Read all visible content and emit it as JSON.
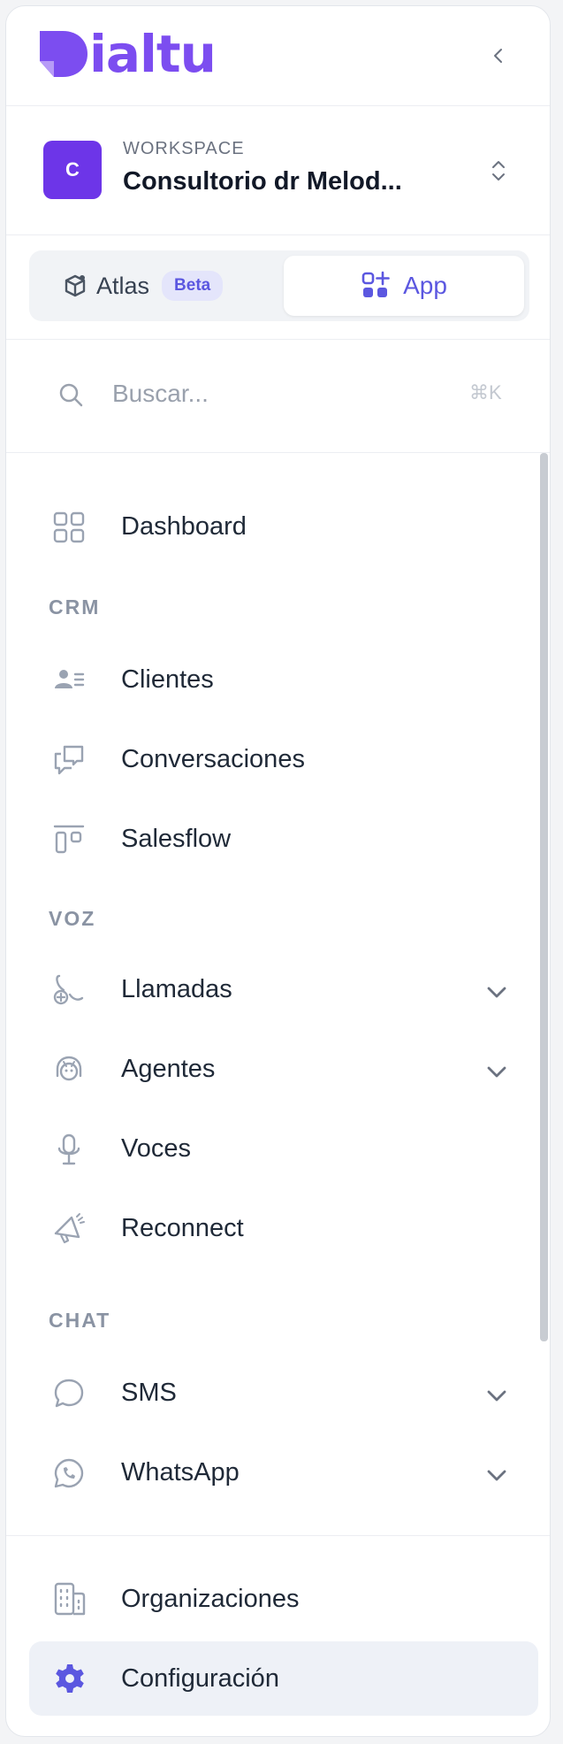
{
  "brand": {
    "name": "ialtu",
    "color": "#7c4df0"
  },
  "workspace": {
    "initial": "C",
    "label": "WORKSPACE",
    "name": "Consultorio dr Melod..."
  },
  "mode_switch": {
    "atlas_label": "Atlas",
    "beta_badge": "Beta",
    "app_label": "App",
    "active": "App"
  },
  "search": {
    "placeholder": "Buscar...",
    "shortcut": "⌘K"
  },
  "nav": {
    "dashboard": "Dashboard",
    "sections": {
      "crm": "CRM",
      "voz": "VOZ",
      "chat": "CHAT"
    },
    "crm_items": [
      "Clientes",
      "Conversaciones",
      "Salesflow"
    ],
    "voz_items": [
      "Llamadas",
      "Agentes",
      "Voces",
      "Reconnect"
    ],
    "chat_items": [
      "SMS",
      "WhatsApp"
    ]
  },
  "footer": {
    "organizations": "Organizaciones",
    "settings": "Configuración",
    "active": "Configuración"
  },
  "colors": {
    "accent": "#5b57e0",
    "icon": "#9aa3b2",
    "avatar": "#6d35e8",
    "active_bg": "#eef1f7"
  }
}
